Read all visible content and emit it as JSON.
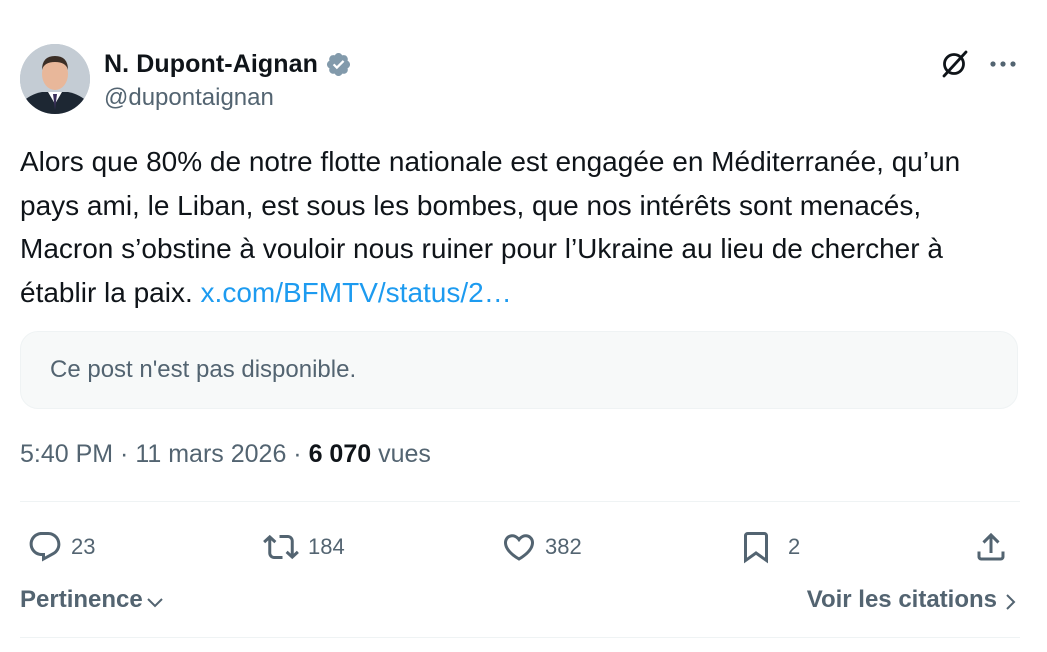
{
  "author": {
    "name": "N. Dupont-Aignan",
    "handle": "@dupontaignan",
    "avatar_icon": "person-avatar",
    "verified_icon": "verified-badge-icon"
  },
  "tweet": {
    "text": "Alors que 80% de notre flotte nationale est engagée en Méditerranée, qu’un pays ami, le Liban, est sous les bombes, que nos intérêts sont menacés, Macron s’obstine à vouloir nous ruiner pour l’Ukraine au lieu de chercher à établir la paix. ",
    "link": "x.com/BFMTV/status/2…",
    "quote_unavailable": "Ce post n'est pas disponible."
  },
  "meta": {
    "time": "5:40 PM",
    "sep1": " · ",
    "date": "11 mars 2026",
    "sep2": " · ",
    "views_count": "6 070",
    "views_label": " vues"
  },
  "actions": {
    "replies": "23",
    "reposts": "184",
    "likes": "382",
    "bookmarks": "2"
  },
  "footer": {
    "sort_label": "Pertinence",
    "quotes_label": "Voir les citations"
  },
  "colors": {
    "text": "#0f1419",
    "secondary": "#536471",
    "link": "#1d9bf0",
    "verified": "#829aab"
  }
}
